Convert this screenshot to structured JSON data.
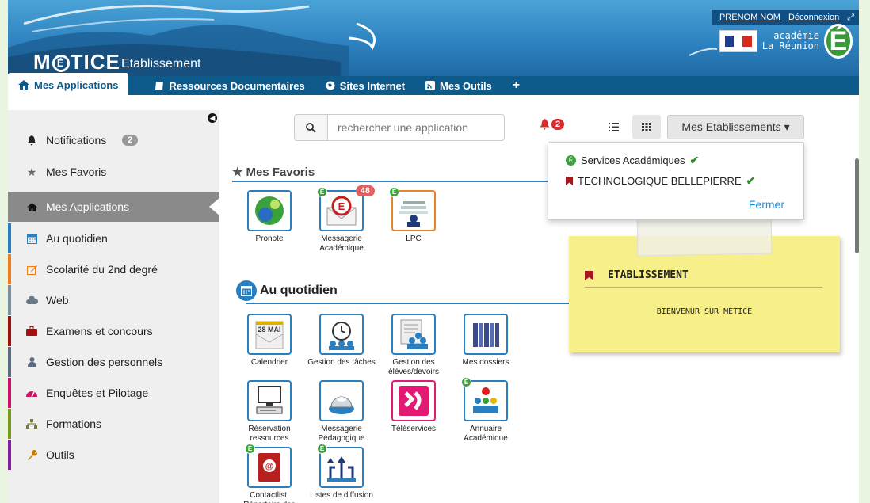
{
  "header": {
    "brand": "M",
    "brand_rest": "TICE",
    "brand_e": "É",
    "subtitle": "Etablissement",
    "user_name": "PRENOM NOM",
    "logout": "Déconnexion",
    "academy_line1": "académie",
    "academy_line2": "La Réunion",
    "academy_e": "É"
  },
  "nav": {
    "items": [
      {
        "label": "Mes Applications"
      },
      {
        "label": "Ressources Documentaires"
      },
      {
        "label": "Sites Internet"
      },
      {
        "label": "Mes Outils"
      }
    ],
    "add": "+"
  },
  "sidebar": {
    "items": [
      {
        "label": "Notifications",
        "badge": "2"
      },
      {
        "label": "Mes Favoris"
      },
      {
        "label": "Mes Applications"
      },
      {
        "label": "Au quotidien",
        "color": "#2a7fc0"
      },
      {
        "label": "Scolarité du 2nd degré",
        "color": "#f07d1a"
      },
      {
        "label": "Web",
        "color": "#7a8fa0"
      },
      {
        "label": "Examens et concours",
        "color": "#a01010"
      },
      {
        "label": "Gestion des personnels",
        "color": "#5a6a80"
      },
      {
        "label": "Enquêtes et Pilotage",
        "color": "#d0106a"
      },
      {
        "label": "Formations",
        "color": "#7a9a1a"
      },
      {
        "label": "Outils",
        "color": "#8a1aa0"
      }
    ]
  },
  "search": {
    "placeholder": "rechercher une application"
  },
  "notifications": {
    "count": "2"
  },
  "etablissements": {
    "button": "Mes Etablissements ▾",
    "items": [
      "Services Académiques",
      "TECHNOLOGIQUE BELLEPIERRE"
    ],
    "close": "Fermer"
  },
  "note": {
    "title": "ETABLISSEMENT",
    "body": "BIENVENUR SUR MÉTICE"
  },
  "favoris": {
    "title": "Mes Favoris",
    "apps": [
      {
        "label": "Pronote"
      },
      {
        "label": "Messagerie Académique",
        "count": "48"
      },
      {
        "label": "LPC"
      }
    ]
  },
  "quotidien": {
    "title": "Au quotidien",
    "calendar_text": "28 MAI",
    "apps": [
      {
        "label": "Calendrier"
      },
      {
        "label": "Gestion des tâches"
      },
      {
        "label": "Gestion des élèves/devoirs"
      },
      {
        "label": "Mes dossiers"
      },
      {
        "label": "Réservation ressources"
      },
      {
        "label": "Messagerie Pédagogique"
      },
      {
        "label": "Téléservices"
      },
      {
        "label": "Annuaire Académique"
      },
      {
        "label": "Contactlist, Répertoire des"
      },
      {
        "label": "Listes de diffusion"
      }
    ]
  },
  "colors": {
    "primary": "#0e5a8a",
    "accent": "#2a7fc0",
    "alert": "#d9292c"
  }
}
